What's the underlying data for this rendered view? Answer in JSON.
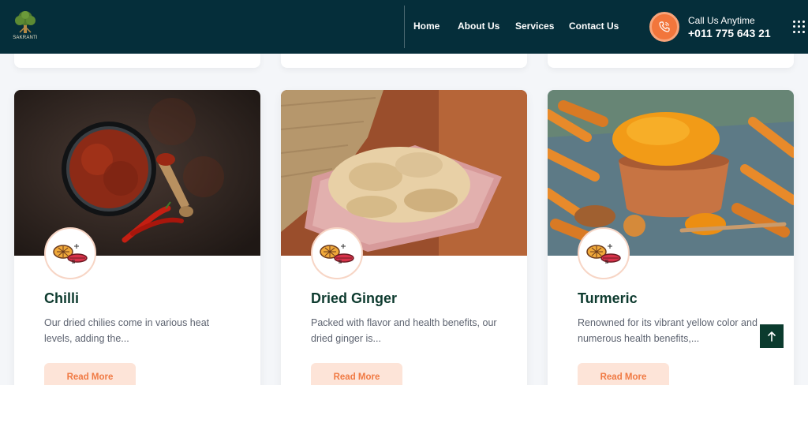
{
  "brand": {
    "logo_text": "SAKRANTI"
  },
  "nav": [
    {
      "label": "Home"
    },
    {
      "label": "About Us"
    },
    {
      "label": "Services"
    },
    {
      "label": "Contact Us"
    }
  ],
  "contact": {
    "label": "Call Us Anytime",
    "number": "+011 775 643 21"
  },
  "cards": [
    {
      "title": "Chilli",
      "description": "Our dried chilies come in various heat levels, adding the...",
      "button": "Read More",
      "image": "dried-chilli-bowl"
    },
    {
      "title": "Dried Ginger",
      "description": "Packed with flavor and health benefits, our dried ginger is...",
      "button": "Read More",
      "image": "dried-ginger-plate"
    },
    {
      "title": "Turmeric",
      "description": "Renowned for its vibrant yellow color and numerous health benefits,...",
      "button": "Read More",
      "image": "turmeric-powder-pot"
    }
  ],
  "icons": {
    "logo": "tree-icon",
    "phone": "phone-icon",
    "menu": "grid-menu-icon",
    "badge": "spices-icon",
    "scroll_top": "arrow-up-icon"
  },
  "colors": {
    "header_bg": "#052e3a",
    "accent": "#f2763c",
    "title": "#0e3b2f",
    "button_bg": "#fde4d8",
    "button_text": "#f07a44"
  }
}
